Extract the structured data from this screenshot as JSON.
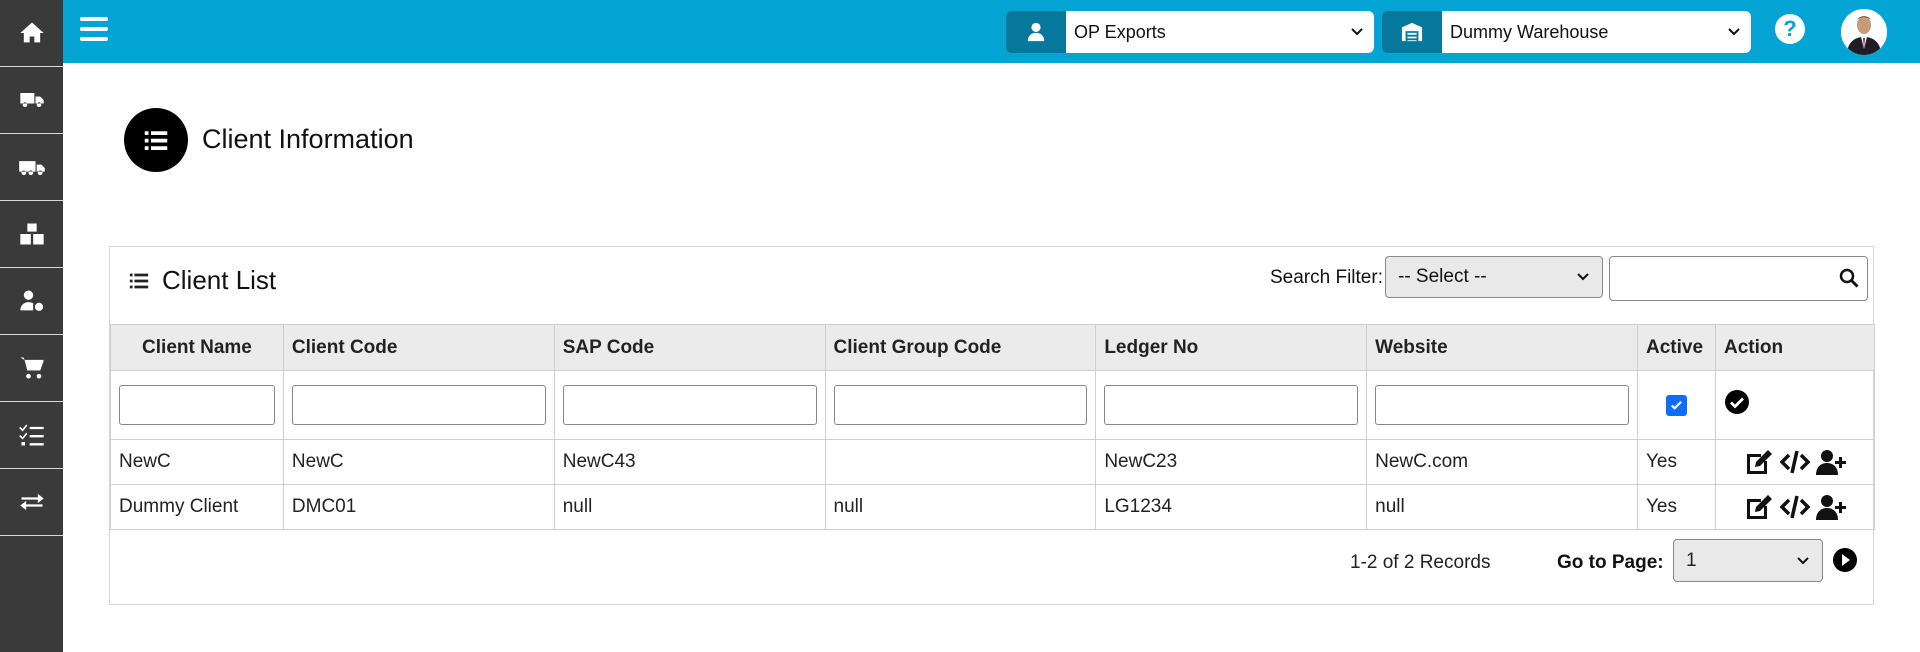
{
  "sidebar": {
    "items": [
      {
        "icon": "home-icon"
      },
      {
        "icon": "truck-icon"
      },
      {
        "icon": "delivery-truck-icon"
      },
      {
        "icon": "boxes-icon"
      },
      {
        "icon": "user-settings-icon"
      },
      {
        "icon": "cart-icon"
      },
      {
        "icon": "checklist-icon"
      },
      {
        "icon": "transfer-icon"
      }
    ]
  },
  "header": {
    "company_select": {
      "icon": "user-icon",
      "value": "OP Exports"
    },
    "warehouse_select": {
      "icon": "warehouse-icon",
      "value": "Dummy Warehouse"
    },
    "help_label": "?",
    "brand_color": "#04a4d5"
  },
  "page": {
    "title": "Client Information",
    "icon": "list-icon"
  },
  "client_list": {
    "title": "Client List",
    "search_filter_label": "Search Filter:",
    "search_filter_value": "-- Select --",
    "columns": [
      "Client Name",
      "Client Code",
      "SAP Code",
      "Client Group Code",
      "Ledger No",
      "Website",
      "Active",
      "Action"
    ],
    "rows": [
      {
        "client_name": "NewC",
        "client_code": "NewC",
        "sap_code": "NewC43",
        "client_group_code": "",
        "ledger_no": "NewC23",
        "website": "NewC.com",
        "active": "Yes"
      },
      {
        "client_name": "Dummy Client",
        "client_code": "DMC01",
        "sap_code": "null",
        "client_group_code": "null",
        "ledger_no": "LG1234",
        "website": "null",
        "active": "Yes"
      }
    ],
    "records_text": "1-2 of 2 Records",
    "goto_label": "Go to Page:",
    "page_value": "1"
  }
}
